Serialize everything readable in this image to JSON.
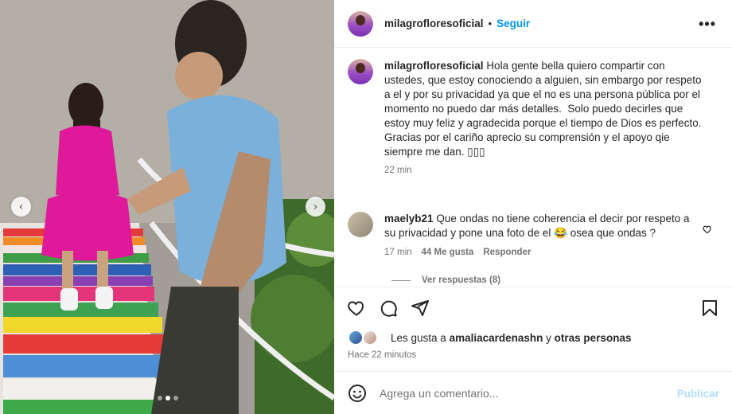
{
  "post": {
    "username": "milagrofloresoficial",
    "follow_label": "Seguir",
    "more_label": "•••",
    "sep": "•"
  },
  "caption": {
    "username": "milagrofloresoficial",
    "text": "Hola gente bella quiero compartir con ustedes, que estoy conociendo a alguien, sin embargo por respeto a el y por su privacidad ya que el no es una persona pública por el momento no puedo dar más detalles.  Solo puedo decirles que estoy muy feliz y agradecida porque el tiempo de Dios es perfecto.\nGracias por el cariño aprecio su comprensión y el apoyo qie siempre me dan. ▯▯▯",
    "time": "22 min"
  },
  "comment": {
    "username": "maelyb21",
    "text": "Que ondas no tiene coherencia el decir por respeto a su privacidad y pone una foto de el 😂 osea que ondas ?",
    "time": "17 min",
    "likes": "44 Me gusta",
    "reply": "Responder"
  },
  "replies_label": "Ver respuestas (8)",
  "likes": {
    "prefix": "Les gusta a",
    "user": "amaliacardenashn",
    "mid": "y",
    "others": "otras personas"
  },
  "posted": "Hace 22 minutos",
  "composer": {
    "placeholder": "Agrega un comentario...",
    "publish": "Publicar"
  },
  "media": {
    "prev": "‹",
    "next": "›",
    "slide_count": 3,
    "active_slide": 1
  },
  "colors": {
    "accent": "#0095f6",
    "muted": "#737373",
    "publish_disabled": "#b2dffc"
  }
}
